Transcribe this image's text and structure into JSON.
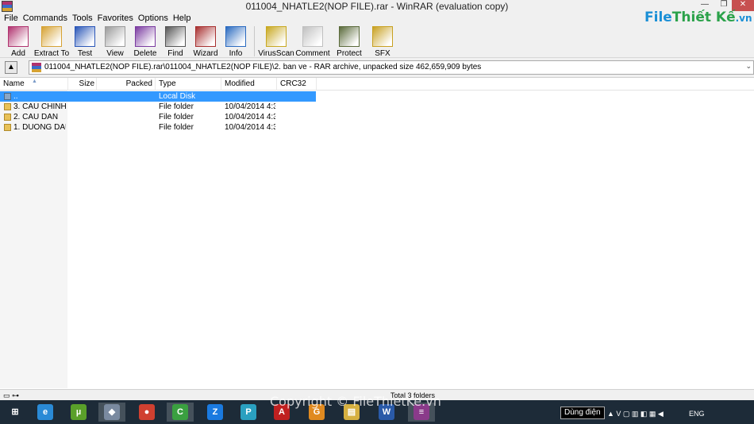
{
  "window": {
    "title": "011004_NHATLE2(NOP FILE).rar - WinRAR (evaluation copy)"
  },
  "menu": [
    "File",
    "Commands",
    "Tools",
    "Favorites",
    "Options",
    "Help"
  ],
  "toolbar": [
    {
      "label": "Add",
      "icon": "add-archive-icon",
      "color": "#b0326e"
    },
    {
      "label": "Extract To",
      "icon": "extract-icon",
      "color": "#d6a233"
    },
    {
      "label": "Test",
      "icon": "test-icon",
      "color": "#2a56b8"
    },
    {
      "label": "View",
      "icon": "view-icon",
      "color": "#9a9a9a"
    },
    {
      "label": "Delete",
      "icon": "delete-icon",
      "color": "#7a3aa0"
    },
    {
      "label": "Find",
      "icon": "find-icon",
      "color": "#555555"
    },
    {
      "label": "Wizard",
      "icon": "wizard-icon",
      "color": "#a83030"
    },
    {
      "label": "Info",
      "icon": "info-icon",
      "color": "#2a6ac0"
    },
    {
      "label": "VirusScan",
      "icon": "virusscan-icon",
      "color": "#c8a820"
    },
    {
      "label": "Comment",
      "icon": "comment-icon",
      "color": "#c0c0c0"
    },
    {
      "label": "Protect",
      "icon": "protect-icon",
      "color": "#5a6a3a"
    },
    {
      "label": "SFX",
      "icon": "sfx-icon",
      "color": "#c8a020"
    }
  ],
  "address": {
    "path": "011004_NHATLE2(NOP FILE).rar\\011004_NHATLE2(NOP FILE)\\2. ban ve - RAR archive, unpacked size 462,659,909 bytes"
  },
  "columns": [
    "Name",
    "Size",
    "Packed",
    "Type",
    "Modified",
    "CRC32"
  ],
  "rows": [
    {
      "name": "..",
      "size": "",
      "packed": "",
      "type": "Local Disk",
      "modified": "",
      "icon": "disk-icon",
      "selected": true
    },
    {
      "name": "3. CAU CHINH",
      "size": "",
      "packed": "",
      "type": "File folder",
      "modified": "10/04/2014 4:3...",
      "icon": "folder-icon",
      "selected": false
    },
    {
      "name": "2. CAU DAN",
      "size": "",
      "packed": "",
      "type": "File folder",
      "modified": "10/04/2014 4:3...",
      "icon": "folder-icon",
      "selected": false
    },
    {
      "name": "1. DUONG DAU ...",
      "size": "",
      "packed": "",
      "type": "File folder",
      "modified": "10/04/2014 4:3...",
      "icon": "folder-icon",
      "selected": false
    }
  ],
  "status": {
    "text": "Total 3 folders"
  },
  "watermark": {
    "brand": "File",
    "rest": "Thiết Kế",
    "ext": ".vn",
    "copyright": "Copyright © FileThietKe.vn"
  },
  "taskbar": {
    "apps": [
      {
        "name": "windows-start-icon",
        "glyph": "⊞",
        "color": "#1d2b38"
      },
      {
        "name": "internet-explorer-icon",
        "glyph": "e",
        "color": "#2a8ad6"
      },
      {
        "name": "utorrent-icon",
        "glyph": "µ",
        "color": "#5aa02a"
      },
      {
        "name": "explorer-app-icon",
        "glyph": "◆",
        "color": "#7a8aa0"
      },
      {
        "name": "chrome-icon",
        "glyph": "●",
        "color": "#d04030"
      },
      {
        "name": "coc-coc-icon",
        "glyph": "C",
        "color": "#3aa040"
      },
      {
        "name": "zalo-icon",
        "glyph": "Z",
        "color": "#1a7ae0"
      },
      {
        "name": "pdf-app-icon",
        "glyph": "P",
        "color": "#2aa0c0"
      },
      {
        "name": "autocad-icon",
        "glyph": "A",
        "color": "#c02020"
      },
      {
        "name": "pdf-foxit-icon",
        "glyph": "G",
        "color": "#e08a20"
      },
      {
        "name": "file-explorer-icon",
        "glyph": "▤",
        "color": "#d6b040"
      },
      {
        "name": "word-icon",
        "glyph": "W",
        "color": "#2a5aa8"
      },
      {
        "name": "winrar-taskbar-icon",
        "glyph": "≡",
        "color": "#8a3a8a"
      }
    ],
    "tray_tip": "Dùng điện",
    "lang": "ENG"
  }
}
